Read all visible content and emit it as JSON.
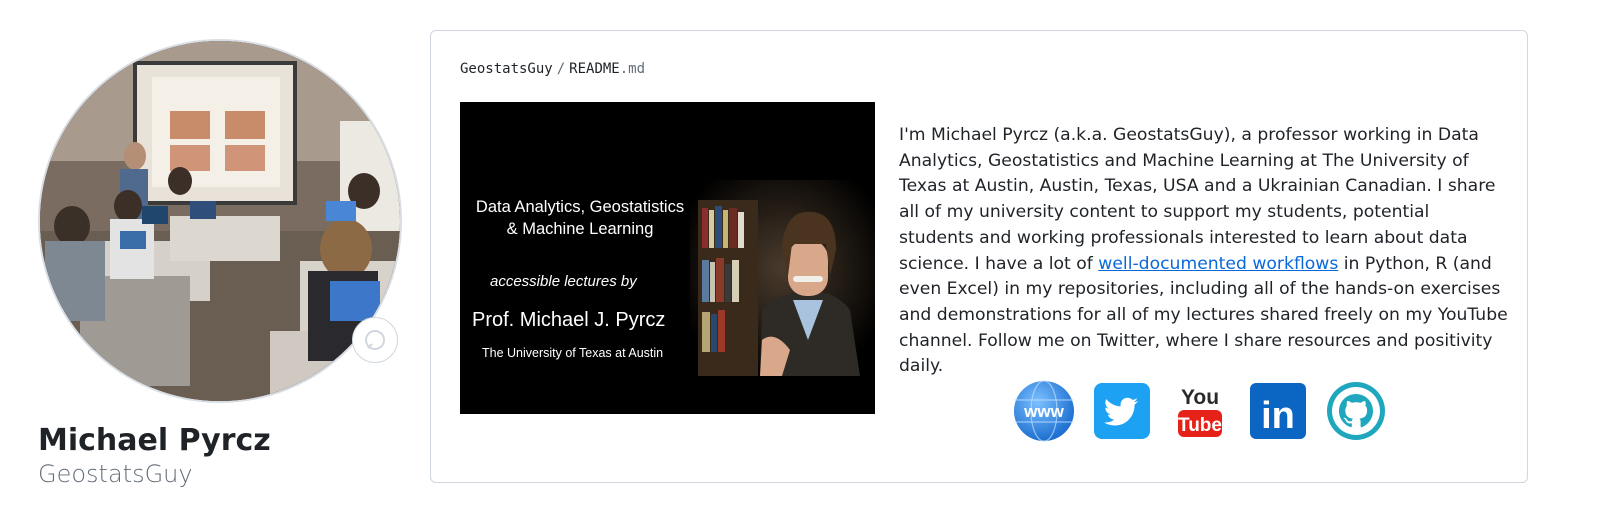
{
  "profile": {
    "name": "Michael Pyrcz",
    "login": "GeostatsGuy"
  },
  "readme": {
    "owner": "GeostatsGuy",
    "separator": "/",
    "file_base": "README",
    "file_ext": ".md",
    "banner": {
      "title_line1": "Data Analytics, Geostatistics",
      "title_line2": "& Machine Learning",
      "subtitle": "accessible lectures by",
      "presenter": "Prof. Michael J. Pyrcz",
      "institution": "The University of Texas at Austin"
    },
    "bio": {
      "before_link": "I'm Michael Pyrcz (a.k.a. GeostatsGuy), a professor working in Data Analytics, Geostatistics and Machine Learning at The University of Texas at Austin, Austin, Texas, USA and a Ukrainian Canadian. I share all of my university content to support my students, potential students and working professionals interested to learn about data science. I have a lot of ",
      "link_text": "well-documented workflows",
      "after_link": " in Python, R (and even Excel) in my repositories, including all of the hands-on exercises and demonstrations for all of my lectures shared freely on my YouTube channel. Follow me on Twitter, where I share resources and positivity daily."
    },
    "socials": [
      {
        "icon": "www-globe-icon",
        "label": "www",
        "color": "#2f8de4"
      },
      {
        "icon": "twitter-icon",
        "color": "#1da1f2"
      },
      {
        "icon": "youtube-icon",
        "label_top": "You",
        "label_bottom": "Tube",
        "color": "#e62117"
      },
      {
        "icon": "linkedin-icon",
        "label": "in",
        "color": "#0a66c2"
      },
      {
        "icon": "github-icon",
        "color": "#1fa7bd"
      }
    ]
  },
  "colors": {
    "link": "#0969da",
    "border": "#d0d7de",
    "text": "#1f2328",
    "muted": "#636c76"
  }
}
